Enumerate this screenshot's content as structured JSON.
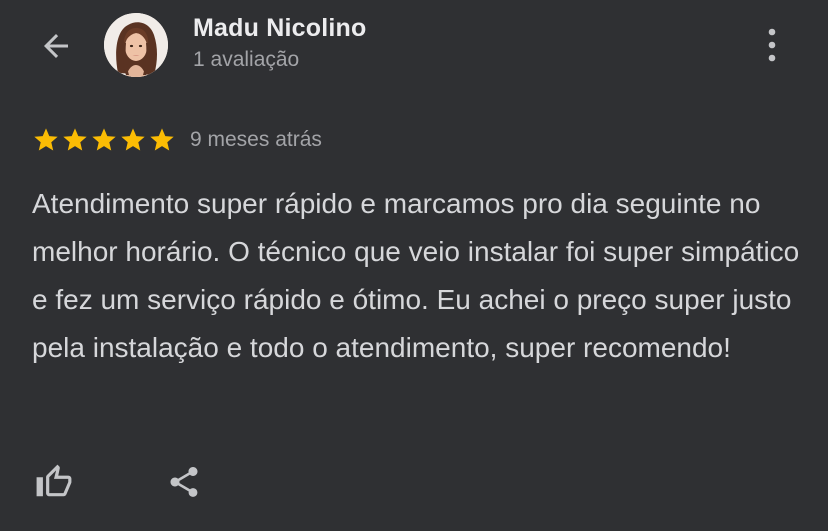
{
  "header": {
    "back_icon": "arrow-left-icon",
    "user_name": "Madu Nicolino",
    "review_count": "1 avaliação",
    "menu_icon": "more-vertical-icon"
  },
  "review": {
    "rating": 5,
    "rating_max": 5,
    "time_ago": "9 meses atrás",
    "text": "Atendimento super rápido e marcamos pro dia seguinte no melhor horário. O técnico que veio instalar foi super simpático e fez um serviço rápido e ótimo. Eu achei o preço super justo pela instalação e todo o atendimento, super recomendo!"
  },
  "actions": {
    "like_icon": "thumbs-up-icon",
    "share_icon": "share-icon"
  },
  "colors": {
    "background": "#2f3033",
    "star": "#fbbc04",
    "text_primary": "#ececee",
    "text_secondary": "#a3a4a8",
    "icon": "#c4c5c8"
  }
}
